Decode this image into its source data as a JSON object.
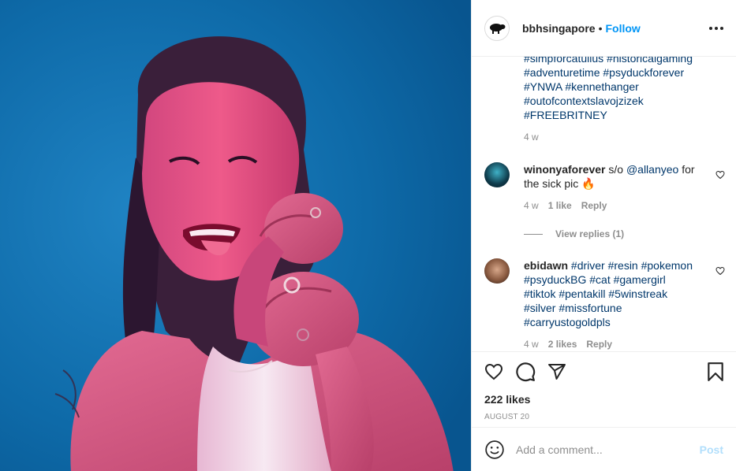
{
  "post": {
    "username": "bbhsingapore",
    "separator": "•",
    "follow_label": "Follow"
  },
  "caption": {
    "lines": [
      "#simpforcatullus #historicalgaming",
      "#adventuretime #psyduckforever",
      "#YNWA #kennethanger",
      "#outofcontextslavojzizek",
      "#FREEBRITNEY"
    ],
    "time": "4 w"
  },
  "comments": [
    {
      "username": "winonyaforever",
      "text_before": " s/o ",
      "mention": "@allanyeo",
      "text_after": " for",
      "line2": "the sick pic 🔥",
      "time": "4 w",
      "likes": "1 like",
      "reply": "Reply",
      "view_replies": "View replies (1)"
    },
    {
      "username": "ebidawn",
      "lines": [
        " #driver #resin #pokemon",
        "#psyduckBG #cat #gamergirl",
        "#tiktok #pentakill #5winstreak",
        "#silver #missfortune",
        "#carryustogoldpls"
      ],
      "time": "4 w",
      "likes": "2 likes",
      "reply": "Reply"
    }
  ],
  "likes_count": "222 likes",
  "date": "AUGUST 20",
  "add_comment": {
    "placeholder": "Add a comment...",
    "post_label": "Post"
  },
  "colors": {
    "link": "#00376b",
    "follow": "#0095f6",
    "post_disabled": "#b2dffc",
    "photo_bg": "#106aa9"
  },
  "icons": [
    "sheep-logo-icon",
    "more-icon",
    "heart-icon",
    "comment-icon",
    "share-icon",
    "bookmark-icon",
    "emoji-icon"
  ]
}
